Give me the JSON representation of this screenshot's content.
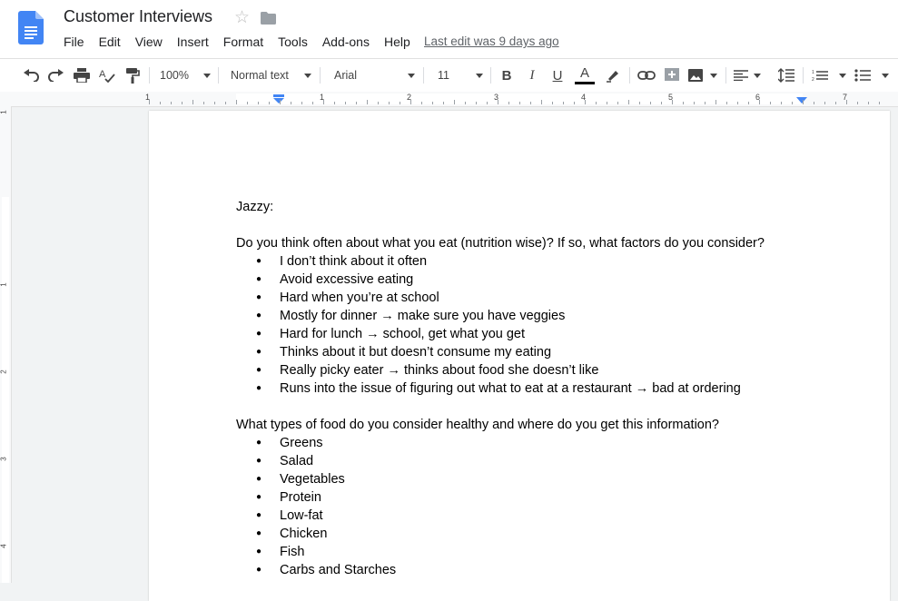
{
  "doc": {
    "title": "Customer Interviews",
    "last_edit": "Last edit was 9 days ago"
  },
  "menu": [
    "File",
    "Edit",
    "View",
    "Insert",
    "Format",
    "Tools",
    "Add-ons",
    "Help"
  ],
  "toolbar": {
    "zoom": "100%",
    "style": "Normal text",
    "font": "Arial",
    "font_size": "11"
  },
  "ruler": {
    "numbers": [
      "1",
      "1",
      "2",
      "3",
      "4",
      "5",
      "6",
      "7"
    ],
    "vertical_numbers": [
      "1",
      "1",
      "2",
      "3",
      "4"
    ]
  },
  "content": {
    "heading": "Jazzy:",
    "q1": "Do you think often about what you eat (nutrition wise)? If so, what factors do you consider?",
    "q1_answers": [
      "I don’t think about it often",
      "Avoid excessive eating",
      "Hard when you’re at school",
      "Mostly for dinner → make sure you have veggies",
      "Hard for lunch → school, get what you get",
      "Thinks about it but doesn’t consume my eating",
      "Really picky eater → thinks about food she doesn’t like",
      "Runs into the issue of figuring out what to eat at a restaurant → bad at ordering"
    ],
    "q2": "What types of food do you consider healthy and where do you get this information?",
    "q2_answers": [
      "Greens",
      "Salad",
      "Vegetables",
      "Protein",
      "Low-fat",
      "Chicken",
      "Fish",
      "Carbs and Starches"
    ]
  },
  "colors": {
    "docs_blue": "#4285f4",
    "text_color_bar": "#000000"
  }
}
